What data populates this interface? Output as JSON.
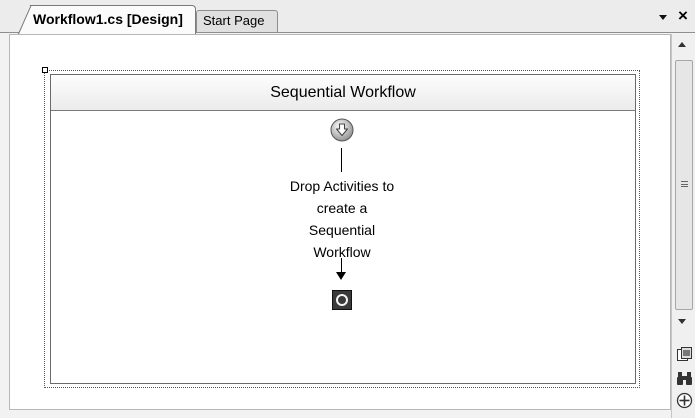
{
  "tabs": {
    "active_label": "Workflow1.cs [Design]",
    "inactive_label": "Start Page",
    "dropdown_icon": "chevron-down-icon",
    "close_label": "×"
  },
  "workflow": {
    "header": "Sequential Workflow",
    "drop_hint_lines": [
      "Drop Activities to",
      "create a",
      "Sequential",
      "Workflow"
    ],
    "start_icon": "start-arrow-icon",
    "end_icon": "end-circle-icon"
  },
  "side_tools": [
    "copy-image-icon",
    "find-binoculars-icon",
    "zoom-pan-icon"
  ]
}
